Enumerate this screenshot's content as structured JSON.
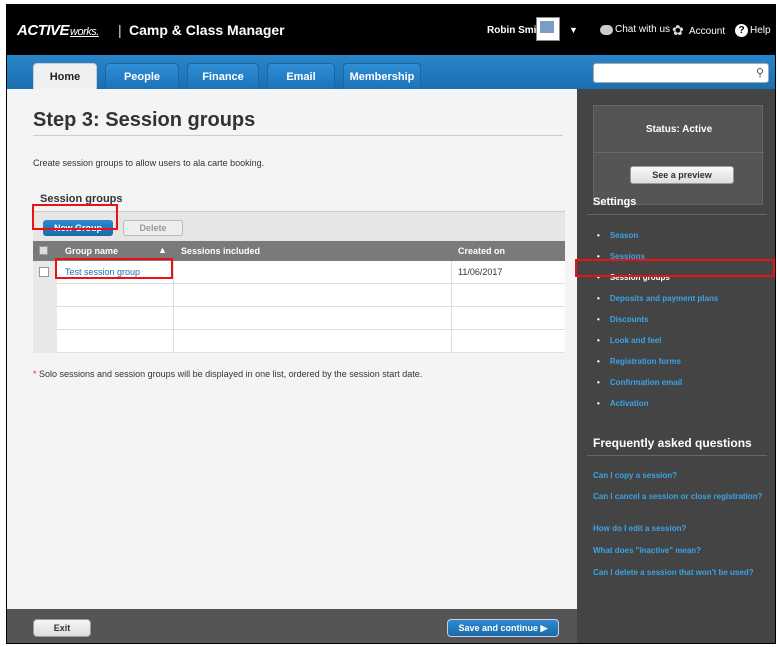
{
  "header": {
    "brand": "ACTIVE",
    "brand_suffix": "works.",
    "separator": "|",
    "app_title": "Camp & Class Manager",
    "user_name": "Robin Smith",
    "chat_label": "Chat with us",
    "account_label": "Account",
    "help_label": "Help"
  },
  "nav": {
    "tabs": [
      {
        "label": "Home"
      },
      {
        "label": "People"
      },
      {
        "label": "Finance"
      },
      {
        "label": "Email"
      },
      {
        "label": "Membership"
      }
    ],
    "search_placeholder": ""
  },
  "main": {
    "title": "Step 3: Session groups",
    "description": "Create session groups to allow users to ala carte booking.",
    "section_title": "Session groups",
    "toolbar": {
      "new_label": "New Group",
      "delete_label": "Delete"
    },
    "table": {
      "columns": [
        "Group name",
        "Sessions included",
        "Created on"
      ],
      "rows": [
        {
          "name": "Test session group",
          "sessions": "",
          "created": "11/06/2017"
        }
      ]
    },
    "note_star": "*",
    "note": " Solo sessions and session groups will be displayed in one list, ordered by the session start date."
  },
  "footer": {
    "exit_label": "Exit",
    "save_label": "Save and continue ▶"
  },
  "sidebar": {
    "status": "Status: Active",
    "preview_label": "See a preview",
    "settings_heading": "Settings",
    "settings_items": [
      {
        "label": "Season"
      },
      {
        "label": "Sessions"
      },
      {
        "label": "Session groups"
      },
      {
        "label": "Deposits and payment plans"
      },
      {
        "label": "Discounts"
      },
      {
        "label": "Look and feel"
      },
      {
        "label": "Registration forms"
      },
      {
        "label": "Confirmation email"
      },
      {
        "label": "Activation"
      }
    ],
    "faq_heading": "Frequently asked questions",
    "faq_items": [
      {
        "label": "Can I copy a session?"
      },
      {
        "label": "Can I cancel a session or close registration?"
      },
      {
        "label": "How do I edit a session?"
      },
      {
        "label": "What does \"inactive\" mean?"
      },
      {
        "label": "Can I delete a session that won't be used?"
      }
    ]
  }
}
